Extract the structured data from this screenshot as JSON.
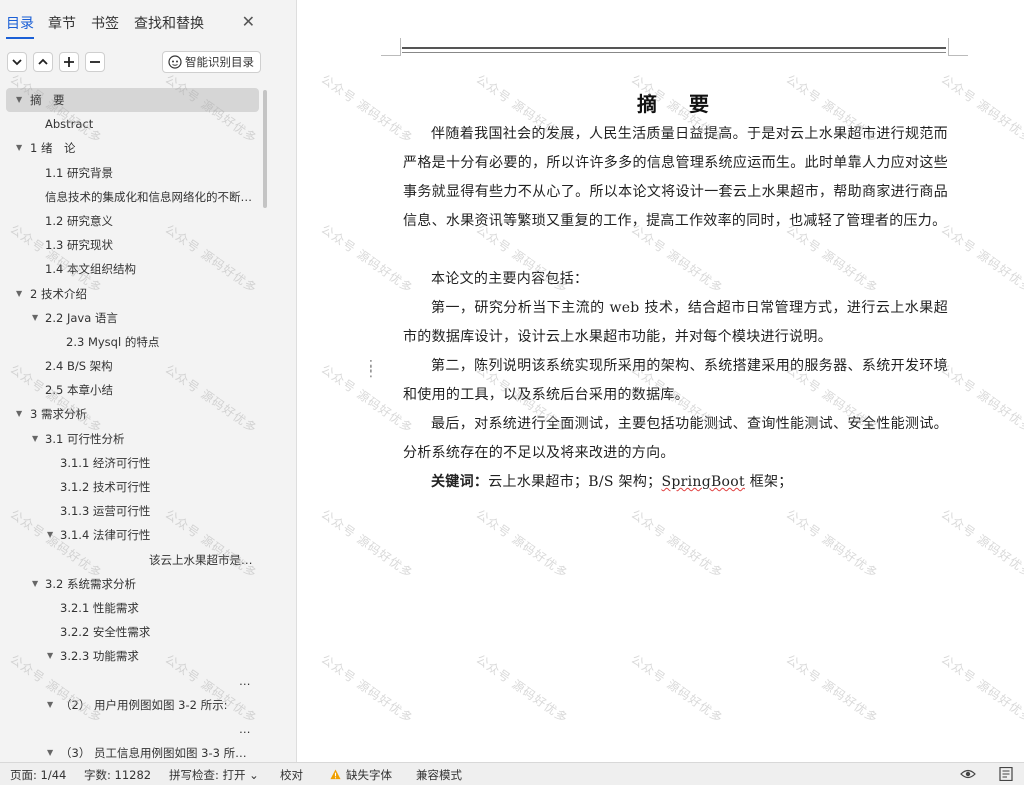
{
  "sidebar": {
    "tabs": [
      "目录",
      "章节",
      "书签",
      "查找和替换"
    ],
    "smart_toc_label": "智能识别目录",
    "toc": [
      {
        "label": "摘　要",
        "level": 0,
        "arrow": true,
        "selected": true
      },
      {
        "label": "Abstract",
        "level": 1,
        "arrow": false
      },
      {
        "label": "1 绪　论",
        "level": 0,
        "arrow": true
      },
      {
        "label": "1.1 研究背景",
        "level": 1,
        "arrow": false
      },
      {
        "label": "信息技术的集成化和信息网络化的不断…",
        "level": 1,
        "arrow": false
      },
      {
        "label": "1.2  研究意义",
        "level": 1,
        "arrow": false
      },
      {
        "label": "1.3 研究现状",
        "level": 1,
        "arrow": false
      },
      {
        "label": "1.4 本文组织结构",
        "level": 1,
        "arrow": false
      },
      {
        "label": "2  技术介绍",
        "level": 0,
        "arrow": true
      },
      {
        "label": "2.2 Java 语言",
        "level": 1,
        "arrow": true
      },
      {
        "label": "2.3 Mysql 的特点",
        "level": 3,
        "arrow": false
      },
      {
        "label": "2.4 B/S 架构",
        "level": 1,
        "arrow": false
      },
      {
        "label": "2.5 本章小结",
        "level": 1,
        "arrow": false
      },
      {
        "label": "3 需求分析",
        "level": 0,
        "arrow": true
      },
      {
        "label": "3.1 可行性分析",
        "level": 1,
        "arrow": true
      },
      {
        "label": "3.1.1 经济可行性",
        "level": 2,
        "arrow": false
      },
      {
        "label": "3.1.2 技术可行性",
        "level": 2,
        "arrow": false
      },
      {
        "label": "3.1.3 运营可行性",
        "level": 2,
        "arrow": false
      },
      {
        "label": "3.1.4 法律可行性",
        "level": 2,
        "arrow": true
      },
      {
        "label": "该云上水果超市是…",
        "level": 4,
        "arrow": false
      },
      {
        "label": "3.2 系统需求分析",
        "level": 1,
        "arrow": true
      },
      {
        "label": "3.2.1  性能需求",
        "level": 2,
        "arrow": false
      },
      {
        "label": "3.2.2  安全性需求",
        "level": 2,
        "arrow": false
      },
      {
        "label": "3.2.3 功能需求",
        "level": 2,
        "arrow": true
      },
      {
        "label": "…",
        "level": 5,
        "arrow": false
      },
      {
        "label": "（2）  用户用例图如图 3-2 所示:",
        "level": 2,
        "arrow": true
      },
      {
        "label": "…",
        "level": 5,
        "arrow": false
      },
      {
        "label": "（3）  员工信息用例图如图 3-3 所示…",
        "level": 2,
        "arrow": true
      }
    ]
  },
  "document": {
    "title": "摘　要",
    "paragraphs": [
      "伴随着我国社会的发展，人民生活质量日益提高。于是对云上水果超市进行规范而严格是十分有必要的，所以许许多多的信息管理系统应运而生。此时单靠人力应对这些事务就显得有些力不从心了。所以本论文将设计一套云上水果超市，帮助商家进行商品信息、水果资讯等繁琐又重复的工作，提高工作效率的同时，也减轻了管理者的压力。",
      "本论文的主要内容包括：",
      "第一，研究分析当下主流的 web 技术，结合超市日常管理方式，进行云上水果超市的数据库设计，设计云上水果超市功能，并对每个模块进行说明。",
      "第二，陈列说明该系统实现所采用的架构、系统搭建采用的服务器、系统开发环境和使用的工具，以及系统后台采用的数据库。",
      "最后，对系统进行全面测试，主要包括功能测试、查询性能测试、安全性能测试。分析系统存在的不足以及将来改进的方向。"
    ],
    "keywords_label": "关键词：",
    "keywords_pre": "云上水果超市；B/S 架构；",
    "keywords_marked": "SpringBoot",
    "keywords_post": " 框架；",
    "watermark": "公众号 源码好优多"
  },
  "status": {
    "page": "页面: 1/44",
    "words": "字数: 11282",
    "spell": "拼写检查: 打开 ⌄",
    "proof": "校对",
    "missing_font": "缺失字体",
    "compat": "兼容模式"
  },
  "icons": {
    "close": "close-icon",
    "expand_all": "chevron-down-icon",
    "collapse_all": "chevron-up-icon",
    "add": "plus-icon",
    "remove": "minus-icon",
    "smart_toc": "robot-icon",
    "warning": "warning-icon",
    "eye": "eye-icon",
    "doc": "document-icon"
  },
  "colors": {
    "accent": "#1a5fd6",
    "warning": "#f0a000"
  }
}
